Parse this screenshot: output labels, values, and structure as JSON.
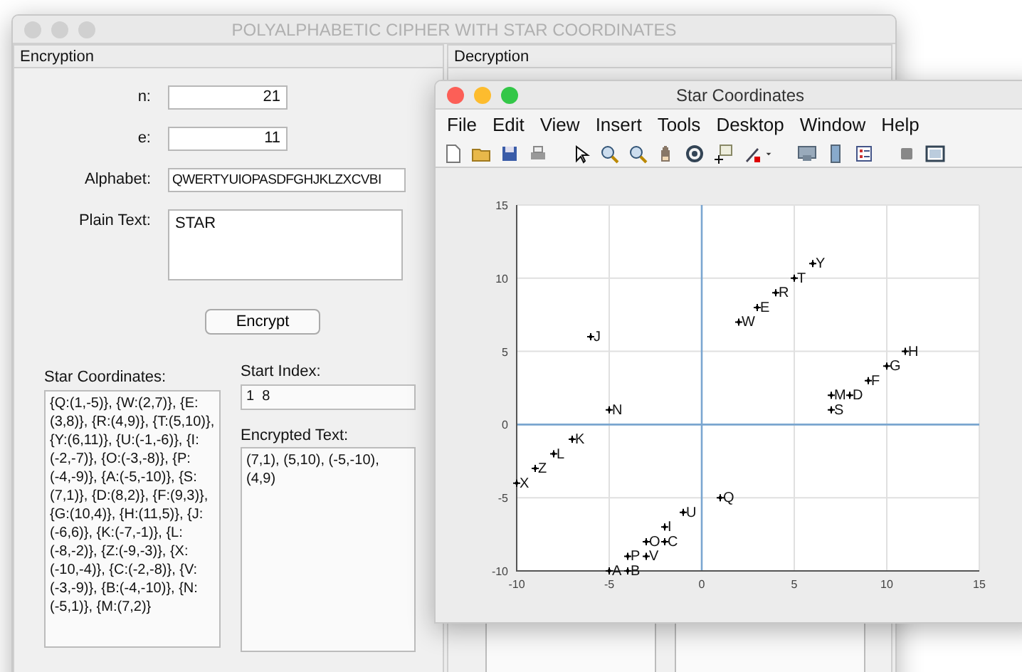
{
  "main_window": {
    "title": "POLYALPHABETIC CIPHER WITH STAR COORDINATES",
    "active": false
  },
  "encryption": {
    "title": "Encryption",
    "fields": [
      {
        "label": "n:",
        "value": "21",
        "kind": "number"
      },
      {
        "label": "e:",
        "value": "11",
        "kind": "number"
      },
      {
        "label": "Alphabet:",
        "value": "QWERTYUIOPASDFGHJKLZXCVBI",
        "kind": "text"
      }
    ],
    "plain_text": {
      "label": "Plain Text:",
      "value": "STAR"
    },
    "encrypt_button": "Encrypt",
    "star_coordinates": {
      "label": "Star Coordinates:",
      "value": "{Q:(1,-5)}, {W:(2,7)}, {E:(3,8)}, {R:(4,9)}, {T:(5,10)}, {Y:(6,11)}, {U:(-1,-6)}, {I:(-2,-7)}, {O:(-3,-8)}, {P:(-4,-9)}, {A:(-5,-10)}, {S:(7,1)}, {D:(8,2)}, {F:(9,3)}, {G:(10,4)}, {H:(11,5)}, {J:(-6,6)}, {K:(-7,-1)}, {L:(-8,-2)}, {Z:(-9,-3)}, {X:(-10,-4)}, {C:(-2,-8)}, {V:(-3,-9)}, {B:(-4,-10)}, {N:(-5,1)}, {M:(7,2)}"
    },
    "start_index": {
      "label": "Start Index:",
      "value": "1  8"
    },
    "encrypted_text": {
      "label": "Encrypted Text:",
      "value": "(7,1), (5,10), (-5,-10), (4,9)"
    }
  },
  "decryption": {
    "title": "Decryption"
  },
  "figure_window": {
    "title": "Star Coordinates",
    "active": true,
    "menu": [
      "File",
      "Edit",
      "View",
      "Insert",
      "Tools",
      "Desktop",
      "Window",
      "Help"
    ],
    "chart_data": {
      "type": "scatter",
      "grid": true,
      "xlim": [
        -10,
        15
      ],
      "ylim": [
        -10,
        15
      ],
      "xticks": [
        -10,
        -5,
        0,
        5,
        10,
        15
      ],
      "yticks": [
        -10,
        -5,
        0,
        5,
        10,
        15
      ],
      "series": [
        {
          "color": "#000000",
          "x": [
            1,
            2,
            3,
            4,
            5,
            6,
            -1,
            -2,
            -3,
            -4,
            -5,
            7,
            8,
            9,
            10,
            11,
            -6,
            -7,
            -8,
            -9,
            -10,
            -2,
            -3,
            -4,
            -5,
            7
          ],
          "values": [
            -5,
            7,
            8,
            9,
            10,
            11,
            -6,
            -7,
            -8,
            -9,
            -10,
            1,
            2,
            3,
            4,
            5,
            6,
            -1,
            -2,
            -3,
            -4,
            -8,
            -9,
            -10,
            1,
            2
          ]
        }
      ],
      "annotations": [
        {
          "x": 1,
          "y": -5,
          "text": "Q"
        },
        {
          "x": 2,
          "y": 7,
          "text": "W"
        },
        {
          "x": 3,
          "y": 8,
          "text": "E"
        },
        {
          "x": 4,
          "y": 9,
          "text": "R"
        },
        {
          "x": 5,
          "y": 10,
          "text": "T"
        },
        {
          "x": 6,
          "y": 11,
          "text": "Y"
        },
        {
          "x": -1,
          "y": -6,
          "text": "U"
        },
        {
          "x": -2,
          "y": -7,
          "text": "I"
        },
        {
          "x": -3,
          "y": -8,
          "text": "O"
        },
        {
          "x": -4,
          "y": -9,
          "text": "P"
        },
        {
          "x": -5,
          "y": -10,
          "text": "A"
        },
        {
          "x": 7,
          "y": 1,
          "text": "S"
        },
        {
          "x": 8,
          "y": 2,
          "text": "D"
        },
        {
          "x": 9,
          "y": 3,
          "text": "F"
        },
        {
          "x": 10,
          "y": 4,
          "text": "G"
        },
        {
          "x": 11,
          "y": 5,
          "text": "H"
        },
        {
          "x": -6,
          "y": 6,
          "text": "J"
        },
        {
          "x": -7,
          "y": -1,
          "text": "K"
        },
        {
          "x": -8,
          "y": -2,
          "text": "L"
        },
        {
          "x": -9,
          "y": -3,
          "text": "Z"
        },
        {
          "x": -10,
          "y": -4,
          "text": "X"
        },
        {
          "x": -2,
          "y": -8,
          "text": "C"
        },
        {
          "x": -3,
          "y": -9,
          "text": "V"
        },
        {
          "x": -4,
          "y": -10,
          "text": "B"
        },
        {
          "x": -5,
          "y": 1,
          "text": "N"
        },
        {
          "x": 7,
          "y": 2,
          "text": "M"
        }
      ]
    }
  }
}
